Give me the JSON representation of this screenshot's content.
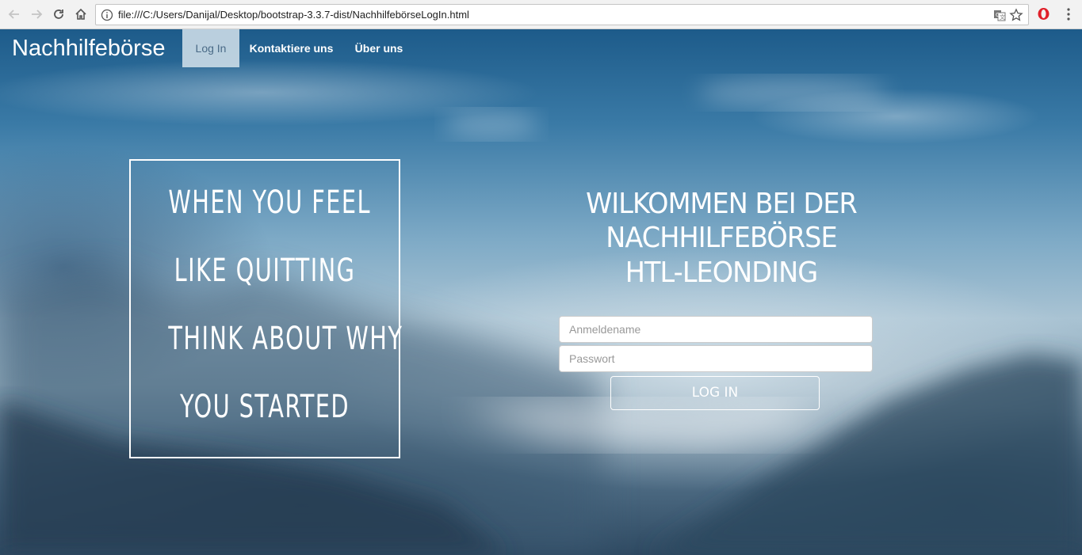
{
  "browser": {
    "url": "file:///C:/Users/Danijal/Desktop/bootstrap-3.3.7-dist/NachhilfebörseLogIn.html"
  },
  "navbar": {
    "brand": "Nachhilfebörse",
    "items": [
      {
        "label": "Log In",
        "active": true
      },
      {
        "label": "Kontaktiere uns",
        "active": false
      },
      {
        "label": "Über uns",
        "active": false
      }
    ]
  },
  "quote": {
    "lines": [
      "WHEN YOU FEEL",
      "LIKE QUITTING",
      "THINK ABOUT WHY",
      "YOU STARTED"
    ]
  },
  "welcome": {
    "lines": [
      "WILKOMMEN BEI DER",
      "NACHHILFEBÖRSE",
      "HTL-LEONDING"
    ]
  },
  "form": {
    "username_placeholder": "Anmeldename",
    "password_placeholder": "Passwort",
    "submit_label": "LOG IN"
  },
  "icons": {
    "back": "back-arrow-icon",
    "forward": "forward-arrow-icon",
    "reload": "reload-icon",
    "home": "home-icon",
    "info": "info-icon",
    "translate": "translate-icon",
    "bookmark": "star-icon",
    "opera": "opera-icon",
    "menu": "kebab-menu-icon"
  },
  "colors": {
    "active_nav_bg": "#c8d9e5",
    "active_nav_text": "#4a6a86",
    "opera_red": "#e0202a"
  }
}
